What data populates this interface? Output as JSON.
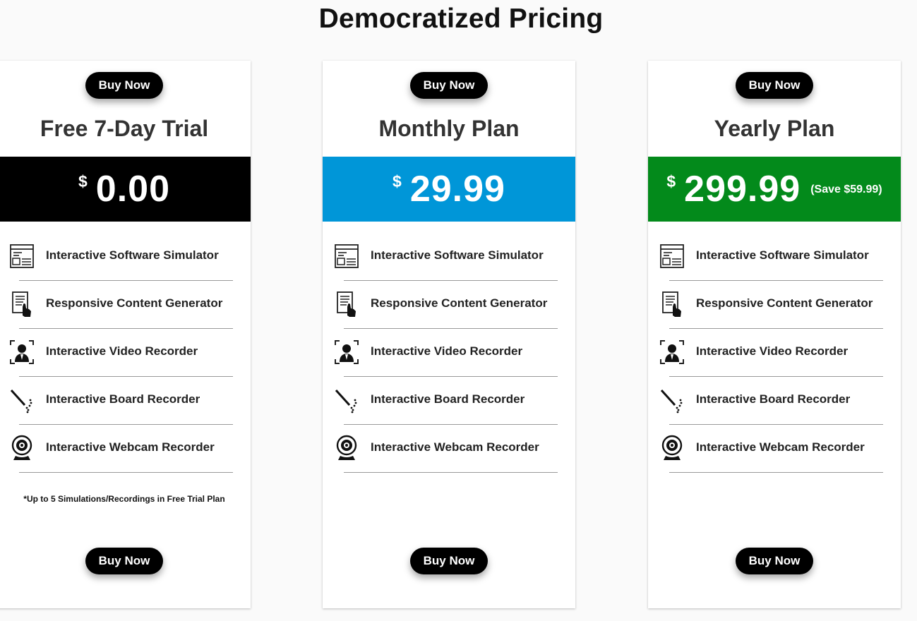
{
  "page": {
    "title": "Democratized Pricing"
  },
  "features": [
    {
      "label": "Interactive Software Simulator",
      "icon": "software-simulator-icon"
    },
    {
      "label": "Responsive Content Generator",
      "icon": "content-generator-icon"
    },
    {
      "label": "Interactive Video Recorder",
      "icon": "video-recorder-icon"
    },
    {
      "label": "Interactive Board Recorder",
      "icon": "board-recorder-icon"
    },
    {
      "label": "Interactive Webcam Recorder",
      "icon": "webcam-recorder-icon"
    }
  ],
  "plans": [
    {
      "name": "Free 7-Day Trial",
      "buy_top": "Buy Now",
      "buy_bottom": "Buy Now",
      "currency": "$",
      "price": "0.00",
      "savings": "",
      "band_color": "#000000",
      "footnote": "*Up to 5 Simulations/Recordings in Free Trial Plan"
    },
    {
      "name": "Monthly Plan",
      "buy_top": "Buy Now",
      "buy_bottom": "Buy Now",
      "currency": "$",
      "price": "29.99",
      "savings": "",
      "band_color": "#0096d8",
      "footnote": ""
    },
    {
      "name": "Yearly Plan",
      "buy_top": "Buy Now",
      "buy_bottom": "Buy Now",
      "currency": "$",
      "price": "299.99",
      "savings": "(Save $59.99)",
      "band_color": "#038a1b",
      "footnote": ""
    }
  ]
}
